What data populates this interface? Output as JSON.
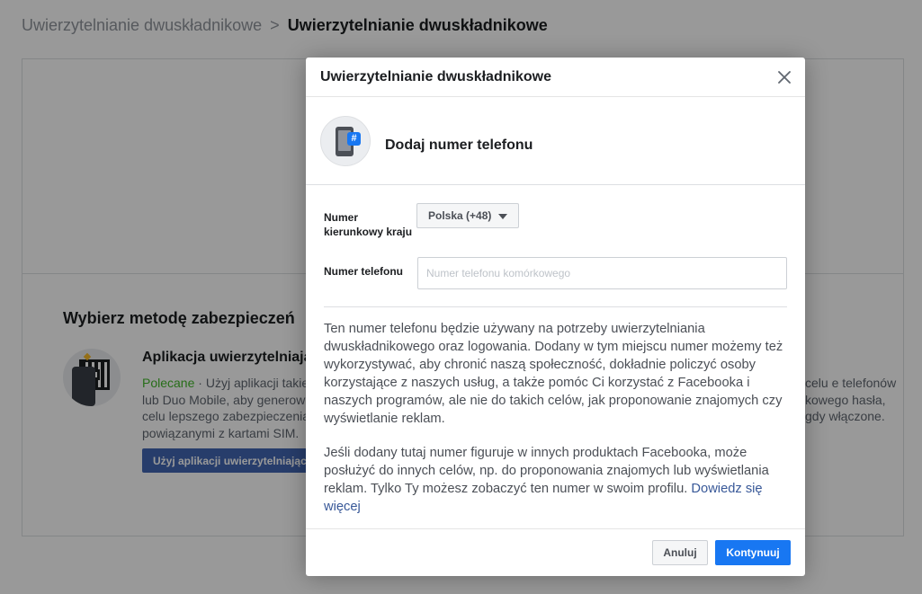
{
  "breadcrumb": {
    "parent": "Uwierzytelnianie dwuskładnikowe",
    "separator": ">",
    "current": "Uwierzytelnianie dwuskładnikowe"
  },
  "background": {
    "section_title": "Wybierz metodę zabezpieczeń",
    "method": {
      "icon": "qr-phone-icon",
      "name": "Aplikacja uwierzytelniają",
      "recommended": "Polecane",
      "description": " · Użyj aplikacji takie lub Duo Mobile, aby generow celu lepszego zabezpieczenia powiązanymi z kartami SIM.",
      "button_label": "Użyj aplikacji uwierzytelniając"
    },
    "right_description": "celu e telefonów kowego hasła, gdy włączone."
  },
  "dialog": {
    "title": "Uwierzytelnianie dwuskładnikowe",
    "close_icon": "close-icon",
    "hero_icon": "phone-hash-icon",
    "hero_badge": "#",
    "hero_title": "Dodaj numer telefonu",
    "country_label": "Numer kierunkowy kraju",
    "country_value": "Polska (+48)",
    "phone_label": "Numer telefonu",
    "phone_placeholder": "Numer telefonu komórkowego",
    "phone_value": "",
    "info_paragraph_1": "Ten numer telefonu będzie używany na potrzeby uwierzytelniania dwuskładnikowego oraz logowania. Dodany w tym miejscu numer możemy też wykorzystywać, aby chronić naszą społeczność, dokładnie policzyć osoby korzystające z naszych usług, a także pomóc Ci korzystać z Facebooka i naszych programów, ale nie do takich celów, jak proponowanie znajomych czy wyświetlanie reklam.",
    "info_paragraph_2": "Jeśli dodany tutaj numer figuruje w innych produktach Facebooka, może posłużyć do innych celów, np. do proponowania znajomych lub wyświetlania reklam. Tylko Ty możesz zobaczyć ten numer w swoim profilu.",
    "learn_more": "Dowiedz się więcej",
    "cancel_label": "Anuluj",
    "continue_label": "Kontynuuj"
  },
  "colors": {
    "primary": "#1877f2",
    "link": "#385898",
    "recommended": "#42b72a",
    "overlay": "rgba(0,0,0,0.4)"
  }
}
